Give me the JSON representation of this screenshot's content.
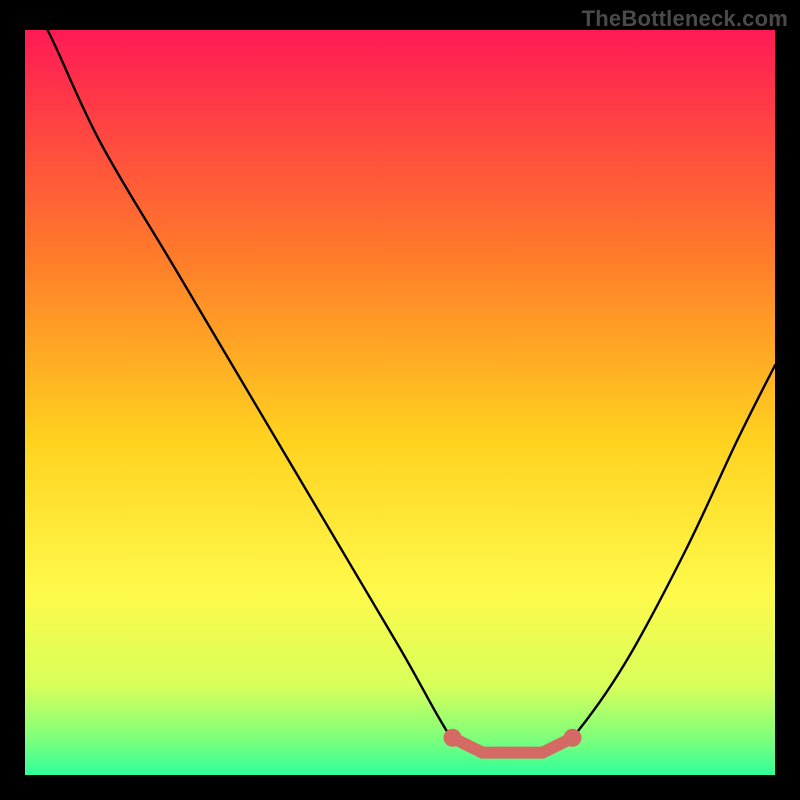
{
  "watermark": "TheBottleneck.com",
  "colors": {
    "background_black": "#000000",
    "gradient_top": "#ff1a55",
    "gradient_mid1": "#ff7a2a",
    "gradient_mid2": "#ffd21f",
    "gradient_mid3": "#fff94a",
    "gradient_bottom1": "#d8ff5a",
    "gradient_bottom2": "#7fff7a",
    "gradient_bottom3": "#2fff9a",
    "curve": "#000000",
    "marker": "#d46a63"
  },
  "chart_data": {
    "type": "line",
    "title": "",
    "xlabel": "",
    "ylabel": "",
    "xlim": [
      0,
      100
    ],
    "ylim": [
      0,
      100
    ],
    "grid": false,
    "series": [
      {
        "name": "bottleneck_curve",
        "x": [
          0,
          3,
          10,
          20,
          30,
          40,
          50,
          55,
          57,
          59,
          61,
          63,
          65,
          67,
          69,
          71,
          73,
          80,
          88,
          95,
          100
        ],
        "y": [
          104,
          100,
          85,
          68,
          51,
          34,
          17,
          8,
          5,
          4,
          3,
          3,
          3,
          3,
          3,
          4,
          5,
          15,
          30,
          45,
          55
        ]
      }
    ],
    "markers": {
      "name": "optimal_range",
      "x": [
        57,
        59,
        61,
        63,
        65,
        67,
        69,
        71,
        73
      ],
      "y": [
        5,
        4,
        3,
        3,
        3,
        3,
        3,
        4,
        5
      ]
    },
    "legend": false
  }
}
